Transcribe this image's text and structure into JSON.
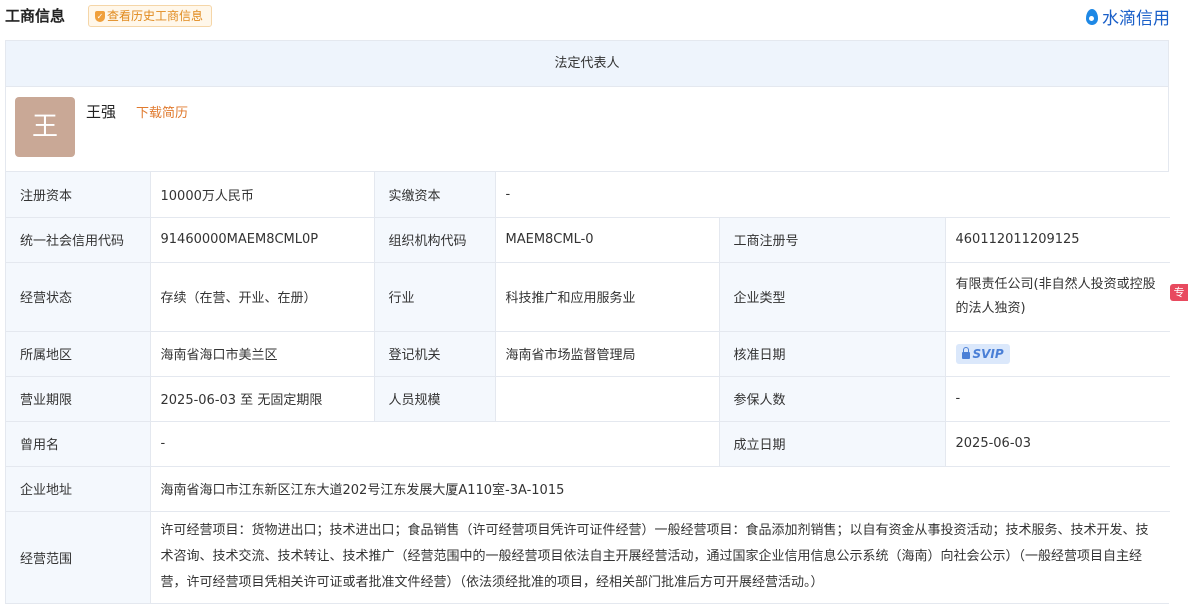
{
  "header": {
    "title": "工商信息",
    "history_button": "查看历史工商信息",
    "brand": "水滴信用"
  },
  "side_tag": "专",
  "legal_rep": {
    "section_title": "法定代表人",
    "avatar_char": "王",
    "name": "王强",
    "download_resume": "下载简历"
  },
  "fields": {
    "reg_capital": {
      "label": "注册资本",
      "value": "10000万人民币"
    },
    "paid_capital": {
      "label": "实缴资本",
      "value": "-"
    },
    "credit_code": {
      "label": "统一社会信用代码",
      "value": "91460000MAEM8CML0P"
    },
    "org_code": {
      "label": "组织机构代码",
      "value": "MAEM8CML-0"
    },
    "reg_no": {
      "label": "工商注册号",
      "value": "460112011209125"
    },
    "status": {
      "label": "经营状态",
      "value": "存续（在营、开业、在册）"
    },
    "industry": {
      "label": "行业",
      "value": "科技推广和应用服务业"
    },
    "company_type": {
      "label": "企业类型",
      "value": "有限责任公司(非自然人投资或控股的法人独资)"
    },
    "region": {
      "label": "所属地区",
      "value": "海南省海口市美兰区"
    },
    "authority": {
      "label": "登记机关",
      "value": "海南省市场监督管理局"
    },
    "approval_date": {
      "label": "核准日期",
      "value": "SVIP"
    },
    "term": {
      "label": "营业期限",
      "value": "2025-06-03 至 无固定期限"
    },
    "staff_size": {
      "label": "人员规模",
      "value": ""
    },
    "insured": {
      "label": "参保人数",
      "value": "-"
    },
    "former_name": {
      "label": "曾用名",
      "value": "-"
    },
    "established": {
      "label": "成立日期",
      "value": "2025-06-03"
    },
    "address": {
      "label": "企业地址",
      "value": "海南省海口市江东新区江东大道202号江东发展大厦A110室-3A-1015"
    },
    "scope": {
      "label": "经营范围",
      "value": "许可经营项目：货物进出口；技术进出口；食品销售（许可经营项目凭许可证件经营）一般经营项目：食品添加剂销售；以自有资金从事投资活动；技术服务、技术开发、技术咨询、技术交流、技术转让、技术推广（经营范围中的一般经营项目依法自主开展经营活动，通过国家企业信用信息公示系统（海南）向社会公示）（一般经营项目自主经营，许可经营项目凭相关许可证或者批准文件经营）（依法须经批准的项目，经相关部门批准后方可开展经营活动。）"
    }
  }
}
